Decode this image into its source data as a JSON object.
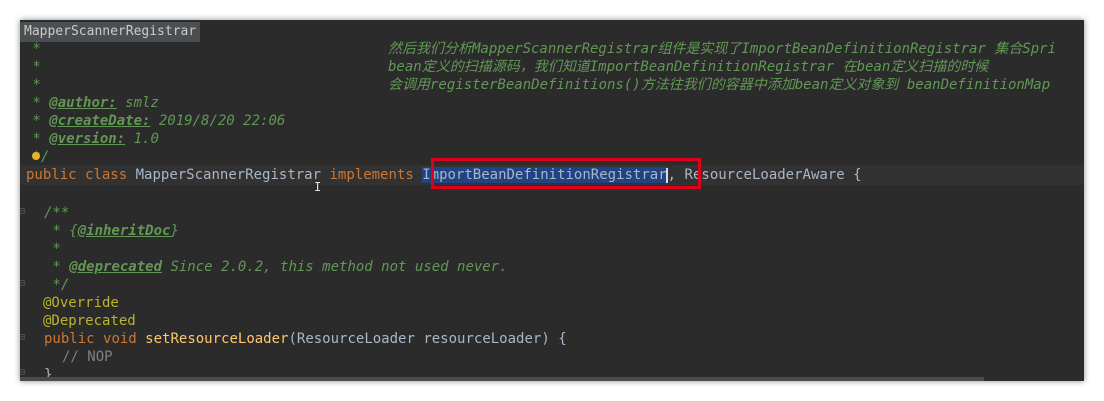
{
  "tab": {
    "title": "MapperScannerRegistrar"
  },
  "code": {
    "l1": {
      "star": " *",
      "text": "然后我们分析MapperScannerRegistrar组件是实现了ImportBeanDefinitionRegistrar 集合Spri"
    },
    "l2": {
      "star": " *",
      "text": "bean定义的扫描源码，我们知道ImportBeanDefinitionRegistrar 在bean定义扫描的时候"
    },
    "l3": {
      "star": " *",
      "text": "会调用registerBeanDefinitions()方法往我们的容器中添加bean定义对象到 beanDefinitionMap"
    },
    "author": {
      "prefix": " * ",
      "tag": "@author:",
      "value": " smlz"
    },
    "createDate": {
      "prefix": " * ",
      "tag": "@createDate:",
      "value": " 2019/8/20 22:06"
    },
    "version": {
      "prefix": " * ",
      "tag": "@version:",
      "value": " 1.0"
    },
    "end_doc": " */",
    "class_decl": {
      "kw1": "public",
      "kw2": "class",
      "name": "MapperScannerRegistrar",
      "implements": "implements",
      "iface1": "ImportBeanDefinitionRegistrar",
      "comma": ",",
      "iface2": "ResourceLoaderAware",
      "brace": "{"
    },
    "m_open": "/**",
    "m_inherit": {
      "prefix": " * {",
      "tag": "@inheritDoc",
      "suffix": "}"
    },
    "m_blank": " *",
    "m_deprecated": {
      "prefix": " * ",
      "tag": "@deprecated",
      "text": " Since 2.0.2, this method not used never."
    },
    "m_close": " */",
    "override": "@Override",
    "deprecated_ann": "@Deprecated",
    "method": {
      "kw1": "public",
      "kw2": "void",
      "name": "setResourceLoader",
      "params": "(ResourceLoader resourceLoader) {"
    },
    "nop": "// NOP",
    "close": "}"
  }
}
